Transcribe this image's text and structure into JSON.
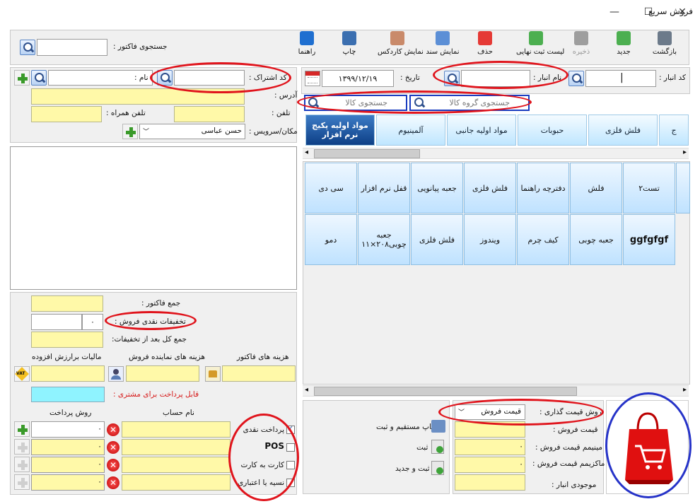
{
  "window": {
    "title": "فروش سریع",
    "min": "—",
    "max": "☐",
    "close": "✕"
  },
  "toolbar": {
    "invoice_search_label": "جستجوی فاکتور :",
    "items": [
      {
        "name": "back",
        "label": "بازگشت",
        "icon": "home-icon",
        "color": "#6c7a8a"
      },
      {
        "name": "new",
        "label": "جدید",
        "icon": "new-doc-icon",
        "color": "#4caf50"
      },
      {
        "name": "save",
        "label": "ذخیره",
        "icon": "save-icon",
        "color": "#9e9e9e"
      },
      {
        "name": "final-list",
        "label": "لیست ثبت نهایی",
        "icon": "check-doc-icon",
        "color": "#4caf50"
      },
      {
        "name": "delete",
        "label": "حذف",
        "icon": "delete-doc-icon",
        "color": "#e53935"
      },
      {
        "name": "show-doc",
        "label": "نمایش سند",
        "icon": "doc-icon",
        "color": "#5c8fd6"
      },
      {
        "name": "cardex",
        "label": "نمایش کاردکس",
        "icon": "cardex-icon",
        "color": "#c98a6a"
      },
      {
        "name": "print",
        "label": "چاپ",
        "icon": "printer-icon",
        "color": "#3b6fb0"
      },
      {
        "name": "help",
        "label": "راهنما",
        "icon": "help-icon",
        "color": "#1f6fd0"
      }
    ]
  },
  "warehouse": {
    "code_label": "کد انبار :",
    "code_value": "",
    "name_label": "نام انبار :",
    "name_value": "",
    "date_label": "تاریخ :",
    "date_value": "۱۳۹۹/۱۲/۱۹"
  },
  "search": {
    "group_placeholder": "جستجوی گروه کالا",
    "item_placeholder": "جستجوی کالا"
  },
  "tabs": [
    "ج",
    "فلش فلزی",
    "حبوبات",
    "مواد اولیه جانبی",
    "آلمینیوم",
    "مواد اولیه پکیج نرم افزار"
  ],
  "products_row1": [
    "تست۲",
    "فلش",
    "دفترچه راهنما",
    "فلش فلزی",
    "جعبه پیانویی",
    "قفل نرم افزار",
    "سی دی"
  ],
  "products_row2": [
    "ggfgfgf",
    "جعبه چوبی",
    "کیف چرم",
    "ویندوز",
    "فلش فلزی",
    "جعبه چوبی۲۰۸×۱۱",
    "دمو"
  ],
  "customer": {
    "code_label": "کد اشتراک :",
    "name_label": "نام :",
    "address_label": "آدرس :",
    "phone_label": "تلفن :",
    "mobile_label": "تلفن همراه :",
    "location_label": "مکان/سرویس :",
    "location_value": "حسن عباسی"
  },
  "totals": {
    "invoice_total": "جمع فاکتور :",
    "cash_discount": "تخفیفات نقدی فروش :",
    "discount_value": "۰",
    "total_after_discount": "جمع کل بعد از تخفیفات:",
    "invoice_costs": "هزینه های فاکتور",
    "agent_costs": "هزینه های نماینده فروش",
    "vat": "مالیات برارزش افزوده",
    "vat_icon": "VAT",
    "payable": "قابل پرداخت برای مشتری :"
  },
  "payment": {
    "account_header": "نام حساب",
    "method_header": "روش پرداخت",
    "rows": [
      {
        "label": "پرداخت نقدی",
        "checked": true,
        "value": "۰"
      },
      {
        "label": "POS",
        "checked": false,
        "value": "۰"
      },
      {
        "label": "کارت به کارت",
        "checked": false,
        "value": "۰"
      },
      {
        "label": "نسیه یا اعتباری",
        "checked": false,
        "value": "۰"
      }
    ]
  },
  "actions": {
    "print_save": "چاپ مستقیم و ثبت",
    "save": "ثبت",
    "save_new": "ثبت و جدید"
  },
  "pricing": {
    "method_label": "روش قیمت گذاری :",
    "method_value": "قیمت فروش",
    "sale_price": "قیمت فروش :",
    "min_price": "مینیمم قیمت فروش :",
    "max_price": "ماکزیمم قیمت فروش :",
    "stock": "موجودی انبار :",
    "zero": "۰"
  },
  "colors": {
    "yellow_field": "#fff9a8",
    "cyan_field": "#8ff3ff",
    "tab_selected": "#0d3f86",
    "annotation_red": "#e0141c",
    "annotation_blue": "#2633c8"
  }
}
